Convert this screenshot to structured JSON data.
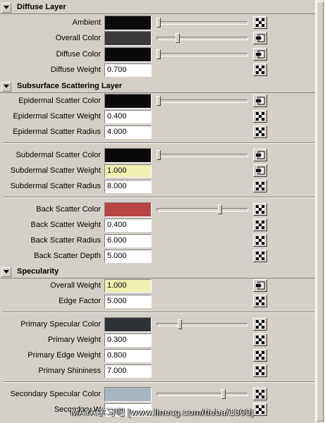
{
  "sections": {
    "diffuse": {
      "title": "Diffuse Layer",
      "rows": [
        {
          "label": "Ambient",
          "color": "#0a0a0a",
          "slider": 0.0,
          "button": "checker-icon"
        },
        {
          "label": "Overall Color",
          "color": "#3b3b3b",
          "slider": 0.22,
          "button": "map-icon"
        },
        {
          "label": "Diffuse Color",
          "color": "#0a0a0a",
          "slider": 0.0,
          "button": "map-icon"
        },
        {
          "label": "Diffuse Weight",
          "value": "0.700",
          "button": "checker-icon"
        }
      ]
    },
    "sss": {
      "title": "Subsurface Scattering Layer",
      "rows": [
        {
          "label": "Epidermal Scatter Color",
          "color": "#0a0a0a",
          "slider": 0.0,
          "button": "map-icon"
        },
        {
          "label": "Epidermal Scatter Weight",
          "value": "0.400",
          "button": "checker-icon"
        },
        {
          "label": "Epidermal Scatter Radius",
          "value": "4.000",
          "button": "checker-icon"
        },
        {
          "label": "Subdermal Scatter Color",
          "color": "#0a0a0a",
          "slider": 0.0,
          "button": "map-icon"
        },
        {
          "label": "Subdermal Scatter Weight",
          "value": "1.000",
          "highlight": true,
          "button": "map-icon"
        },
        {
          "label": "Subdermal Scatter Radius",
          "value": "8.000",
          "button": "checker-icon"
        },
        {
          "label": "Back Scatter Color",
          "color": "#b84444",
          "slider": 0.7,
          "button": "checker-icon"
        },
        {
          "label": "Back Scatter Weight",
          "value": "0.400",
          "button": "checker-icon"
        },
        {
          "label": "Back Scatter Radius",
          "value": "6.000",
          "button": "checker-icon"
        },
        {
          "label": "Back Scatter Depth",
          "value": "5.000",
          "button": "checker-icon"
        }
      ]
    },
    "spec": {
      "title": "Specularity",
      "rows": [
        {
          "label": "Overall Weight",
          "value": "1.000",
          "highlight": true,
          "button": "map-icon"
        },
        {
          "label": "Edge Factor",
          "value": "5.000",
          "button": "checker-icon"
        },
        {
          "label": "Primary Specular Color",
          "color": "#2e3236",
          "slider": 0.24,
          "button": "checker-icon"
        },
        {
          "label": "Primary Weight",
          "value": "0.300",
          "button": "checker-icon"
        },
        {
          "label": "Primary Edge Weight",
          "value": "0.800",
          "button": "checker-icon"
        },
        {
          "label": "Primary Shininess",
          "value": "7.000",
          "button": "checker-icon"
        },
        {
          "label": "Secondary Specular Color",
          "color": "#aab4c0",
          "slider": 0.74,
          "button": "checker-icon"
        },
        {
          "label": "Secondary W",
          "value": "",
          "button": "checker-icon"
        }
      ]
    }
  },
  "watermark": "MAYA学习吧 [www.linecg.com/tieba/1800]"
}
